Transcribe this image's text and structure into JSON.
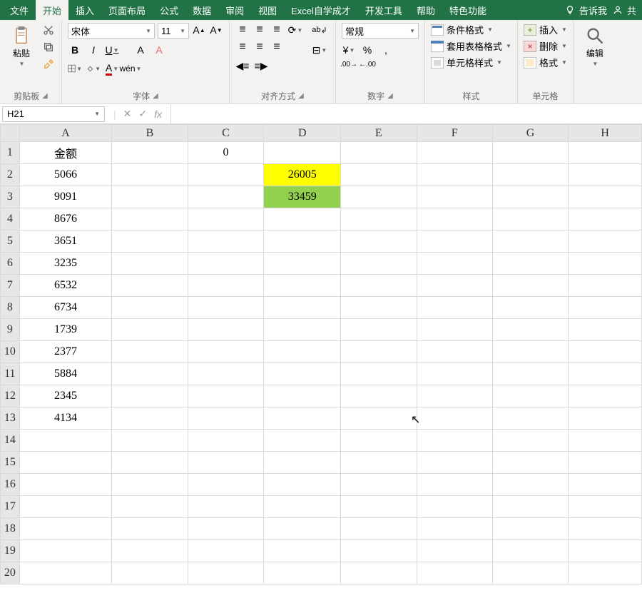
{
  "menu": {
    "items": [
      "文件",
      "开始",
      "插入",
      "页面布局",
      "公式",
      "数据",
      "审阅",
      "视图",
      "Excel自学成才",
      "开发工具",
      "帮助",
      "特色功能"
    ],
    "active_index": 1,
    "tell_me": "告诉我",
    "account": "共"
  },
  "ribbon": {
    "clipboard": {
      "paste": "粘贴",
      "label": "剪贴板"
    },
    "font": {
      "name": "宋体",
      "size": "11",
      "label": "字体"
    },
    "align": {
      "wrap": "ab",
      "merge": "",
      "label": "对齐方式"
    },
    "number": {
      "format": "常规",
      "label": "数字"
    },
    "styles": {
      "cond": "条件格式",
      "table": "套用表格格式",
      "cell": "单元格样式",
      "label": "样式"
    },
    "cells": {
      "insert": "插入",
      "delete": "删除",
      "format": "格式",
      "label": "单元格"
    },
    "editing": {
      "label": "编辑"
    }
  },
  "namebox": "H21",
  "formula": "",
  "columns": [
    "A",
    "B",
    "C",
    "D",
    "E",
    "F",
    "G",
    "H"
  ],
  "rows": [
    "1",
    "2",
    "3",
    "4",
    "5",
    "6",
    "7",
    "8",
    "9",
    "10",
    "11",
    "12",
    "13",
    "14",
    "15",
    "16",
    "17",
    "18",
    "19",
    "20"
  ],
  "cells": {
    "A1": "金额",
    "C1": "0",
    "A2": "5066",
    "D2": "26005",
    "A3": "9091",
    "D3": "33459",
    "A4": "8676",
    "A5": "3651",
    "A6": "3235",
    "A7": "6532",
    "A8": "6734",
    "A9": "1739",
    "A10": "2377",
    "A11": "5884",
    "A12": "2345",
    "A13": "4134"
  },
  "highlights": {
    "D2": "hl-yellow",
    "D3": "hl-green"
  },
  "chart_data": {
    "type": "table",
    "title": "金额",
    "categories": [
      "row2",
      "row3",
      "row4",
      "row5",
      "row6",
      "row7",
      "row8",
      "row9",
      "row10",
      "row11",
      "row12",
      "row13"
    ],
    "series": [
      {
        "name": "A",
        "values": [
          5066,
          9091,
          8676,
          3651,
          3235,
          6532,
          6734,
          1739,
          2377,
          5884,
          2345,
          4134
        ]
      },
      {
        "name": "D",
        "values": [
          26005,
          33459,
          null,
          null,
          null,
          null,
          null,
          null,
          null,
          null,
          null,
          null
        ]
      }
    ],
    "C1": 0
  }
}
